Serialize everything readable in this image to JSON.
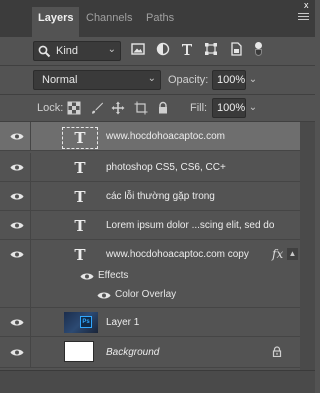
{
  "tabs": [
    {
      "label": "Layers",
      "active": true
    },
    {
      "label": "Channels",
      "active": false
    },
    {
      "label": "Paths",
      "active": false
    }
  ],
  "tab_close": "x",
  "filter": {
    "kind_label": "Kind",
    "icons": [
      "image-filter-icon",
      "adjustment-filter-icon",
      "type-filter-icon",
      "shape-filter-icon",
      "smart-object-filter-icon"
    ]
  },
  "blend": {
    "mode": "Normal",
    "opacity_label": "Opacity:",
    "opacity_value": "100%",
    "fill_label": "Fill:",
    "fill_value": "100%"
  },
  "lock": {
    "label": "Lock:",
    "icons": [
      "lock-transparent-pixels-icon",
      "lock-image-pixels-icon",
      "lock-position-icon",
      "lock-artboard-icon",
      "lock-all-icon"
    ]
  },
  "layers": [
    {
      "name": "www.hocdohoacaptoc.com",
      "type": "text",
      "selected": true
    },
    {
      "name": "photoshop CS5, CS6, CC+",
      "type": "text",
      "selected": false
    },
    {
      "name": "các lỗi  thường gặp trong",
      "type": "text",
      "selected": false
    },
    {
      "name": "Lorem ipsum dolor ...scing elit, sed do",
      "type": "text",
      "selected": false
    },
    {
      "name": "www.hocdohoacaptoc.com copy",
      "type": "text",
      "selected": false,
      "fx": "fx"
    },
    {
      "name": "Layer 1",
      "type": "image",
      "selected": false,
      "thumb_badge": "Ps"
    },
    {
      "name": "Background",
      "type": "background",
      "selected": false,
      "locked": true
    }
  ],
  "effects": {
    "label": "Effects",
    "items": [
      "Color Overlay"
    ]
  },
  "text_thumb_glyph": "T",
  "colors": {
    "panel_bg": "#535353",
    "tab_bar_bg": "#3c3c3c",
    "selected_row_bg": "#6e6e6e",
    "field_bg": "#3a3a3a"
  }
}
